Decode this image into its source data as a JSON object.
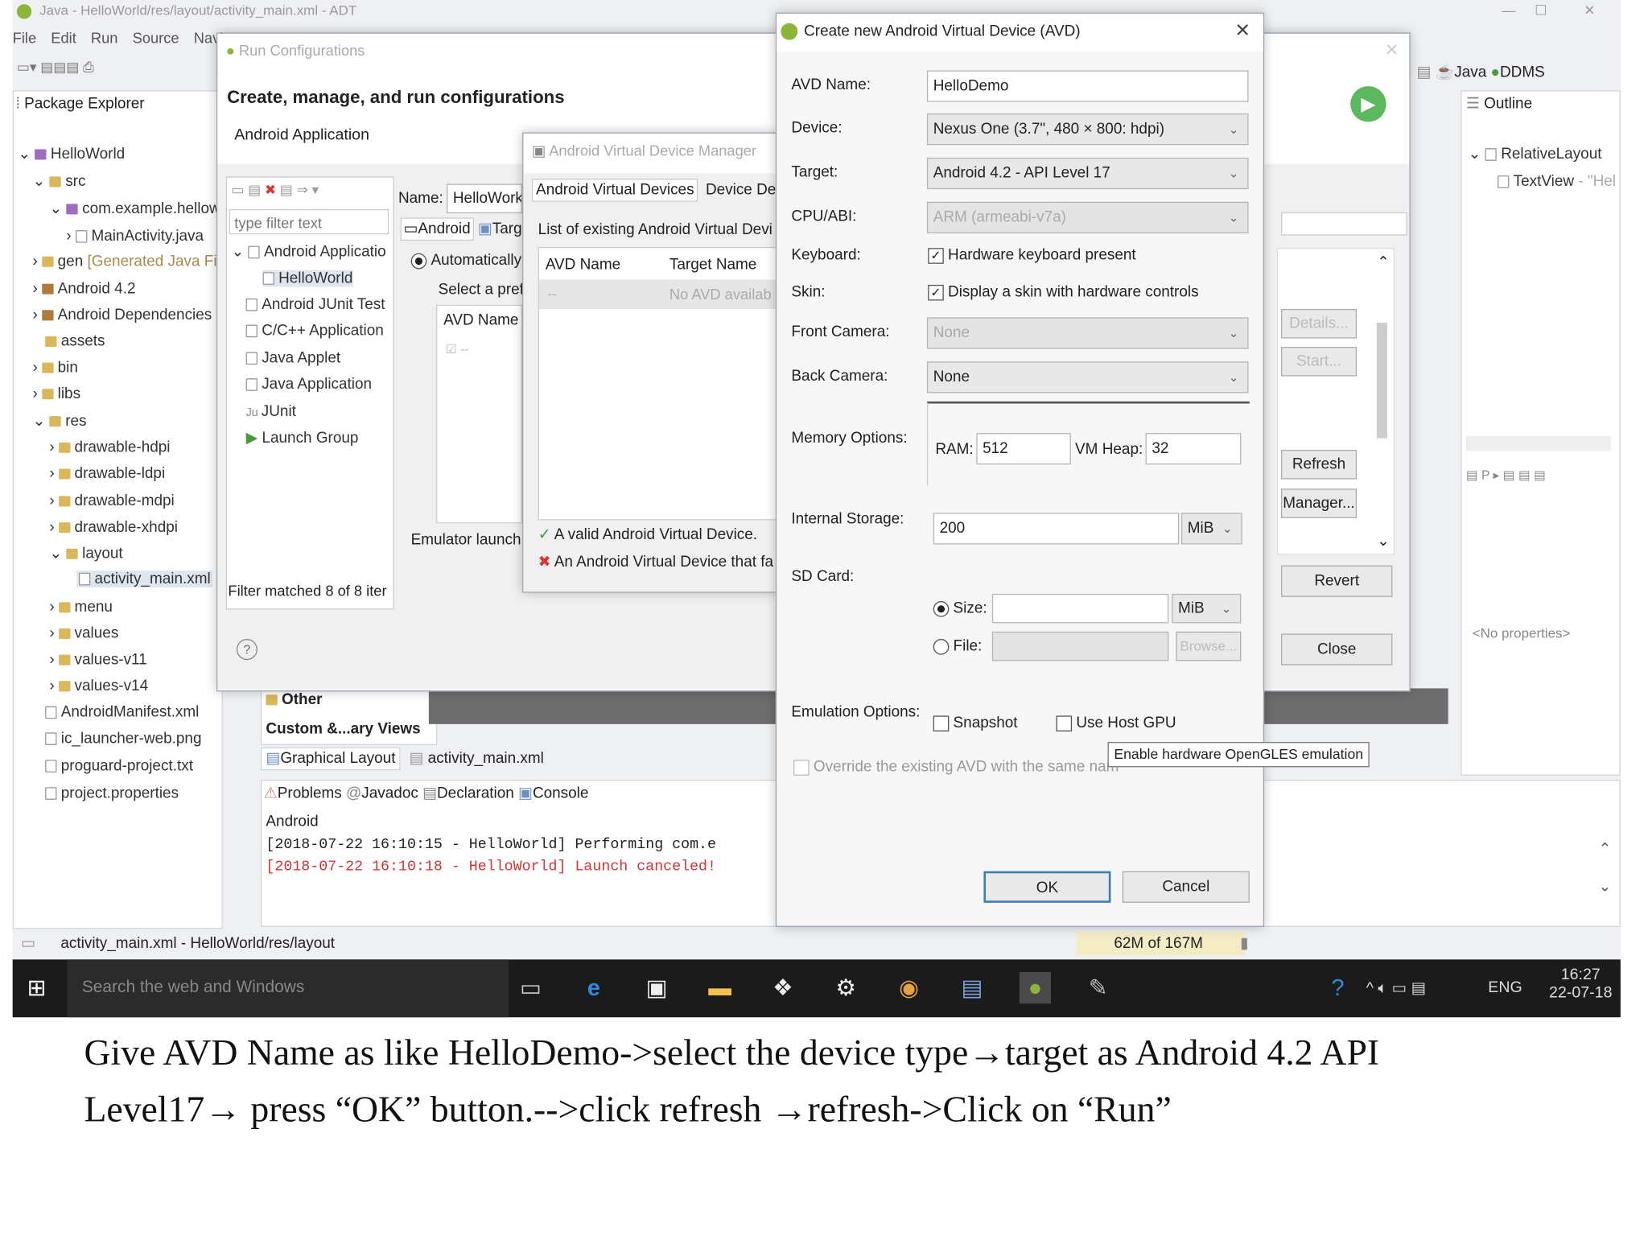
{
  "window": {
    "title": "Java - HelloWorld/res/layout/activity_main.xml - ADT"
  },
  "menu": [
    "File",
    "Edit",
    "Run",
    "Source",
    "Navig"
  ],
  "package_explorer": {
    "title": "Package Explorer",
    "items": [
      "HelloWorld",
      "src",
      "com.example.hellow",
      "MainActivity.java",
      "gen",
      "[Generated Java Fi",
      "Android 4.2",
      "Android Dependencies",
      "assets",
      "bin",
      "libs",
      "res",
      "drawable-hdpi",
      "drawable-ldpi",
      "drawable-mdpi",
      "drawable-xhdpi",
      "layout",
      "activity_main.xml",
      "menu",
      "values",
      "values-v11",
      "values-v14",
      "AndroidManifest.xml",
      "ic_launcher-web.png",
      "proguard-project.txt",
      "project.properties"
    ]
  },
  "perspectives": {
    "java": "Java",
    "ddms": "DDMS"
  },
  "outline": {
    "title": "Outline",
    "items": [
      "RelativeLayout",
      "TextView",
      "- \"Hel"
    ],
    "no_props": "<No properties>"
  },
  "run_config": {
    "title": "Run Configurations",
    "heading": "Create, manage, and run configurations",
    "sub": "Android Application",
    "filter_placeholder": "type filter text",
    "tree": [
      "Android Applicatio",
      "HelloWorld",
      "Android JUnit Test",
      "C/C++ Application",
      "Java Applet",
      "Java Application",
      "JUnit",
      "Launch Group"
    ],
    "filter_status": "Filter matched 8 of 8 iter",
    "name_label": "Name:",
    "name_value": "HelloWork",
    "tabs": [
      "Android",
      "Targ"
    ],
    "auto": "Automatically",
    "select_pref": "Select a pref",
    "avd_col": "AVD Name",
    "emulator_launch": "Emulator launch",
    "buttons": {
      "details": "Details...",
      "start": "Start...",
      "refresh": "Refresh",
      "manager": "Manager...",
      "revert": "Revert",
      "close": "Close"
    },
    "help": "?"
  },
  "avd_manager": {
    "title": "Android Virtual Device Manager",
    "tabs": [
      "Android Virtual Devices",
      "Device Defi"
    ],
    "list_label": "List of existing Android Virtual Devi",
    "cols": [
      "AVD Name",
      "Target Name"
    ],
    "row": [
      "--",
      "No AVD availab"
    ],
    "msg_ok": "A valid Android Virtual Device.",
    "msg_err": "An Android Virtual Device that fa"
  },
  "avd_dialog": {
    "title": "Create new Android Virtual Device (AVD)",
    "close": "✕",
    "labels": {
      "avd_name": "AVD Name:",
      "device": "Device:",
      "target": "Target:",
      "cpu": "CPU/ABI:",
      "keyboard": "Keyboard:",
      "skin": "Skin:",
      "front": "Front Camera:",
      "back": "Back Camera:",
      "memory": "Memory Options:",
      "internal": "Internal Storage:",
      "sdcard": "SD Card:",
      "emulation": "Emulation Options:"
    },
    "avd_name": "HelloDemo",
    "device": "Nexus One (3.7\", 480 × 800: hdpi)",
    "target": "Android 4.2 - API Level 17",
    "cpu": "ARM (armeabi-v7a)",
    "keyboard": "Hardware keyboard present",
    "skin": "Display a skin with hardware controls",
    "front_camera": "None",
    "back_camera": "None",
    "ram_label": "RAM:",
    "ram": "512",
    "vmheap_label": "VM Heap:",
    "vmheap": "32",
    "internal_value": "200",
    "internal_unit": "MiB",
    "size_label": "Size:",
    "size_unit": "MiB",
    "file_label": "File:",
    "browse": "Browse...",
    "snapshot": "Snapshot",
    "host_gpu": "Use Host GPU",
    "tooltip": "Enable hardware OpenGLES emulation",
    "override": "Override the existing AVD with the same nam",
    "ok": "OK",
    "cancel": "Cancel"
  },
  "palette": {
    "other": "Other",
    "custom": "Custom &...ary Views"
  },
  "editor_tabs": [
    "Graphical Layout",
    "activity_main.xml"
  ],
  "console": {
    "tabs": [
      "Problems",
      "Javadoc",
      "Declaration",
      "Console"
    ],
    "label": "Android",
    "line1": "[2018-07-22 16:10:15 - HelloWorld] Performing com.e",
    "line2": "[2018-07-22 16:10:18 - HelloWorld] Launch canceled!"
  },
  "status": {
    "path": "activity_main.xml - HelloWorld/res/layout",
    "memory": "62M of 167M"
  },
  "taskbar": {
    "search": "Search the web and Windows",
    "lang": "ENG",
    "time": "16:27",
    "date": "22-07-18"
  },
  "caption": {
    "line1": "Give AVD Name as like HelloDemo->select the device type→target as Android 4.2 API",
    "line2": "Level17→ press “OK” button.-->click refresh →refresh->Click on “Run”"
  }
}
